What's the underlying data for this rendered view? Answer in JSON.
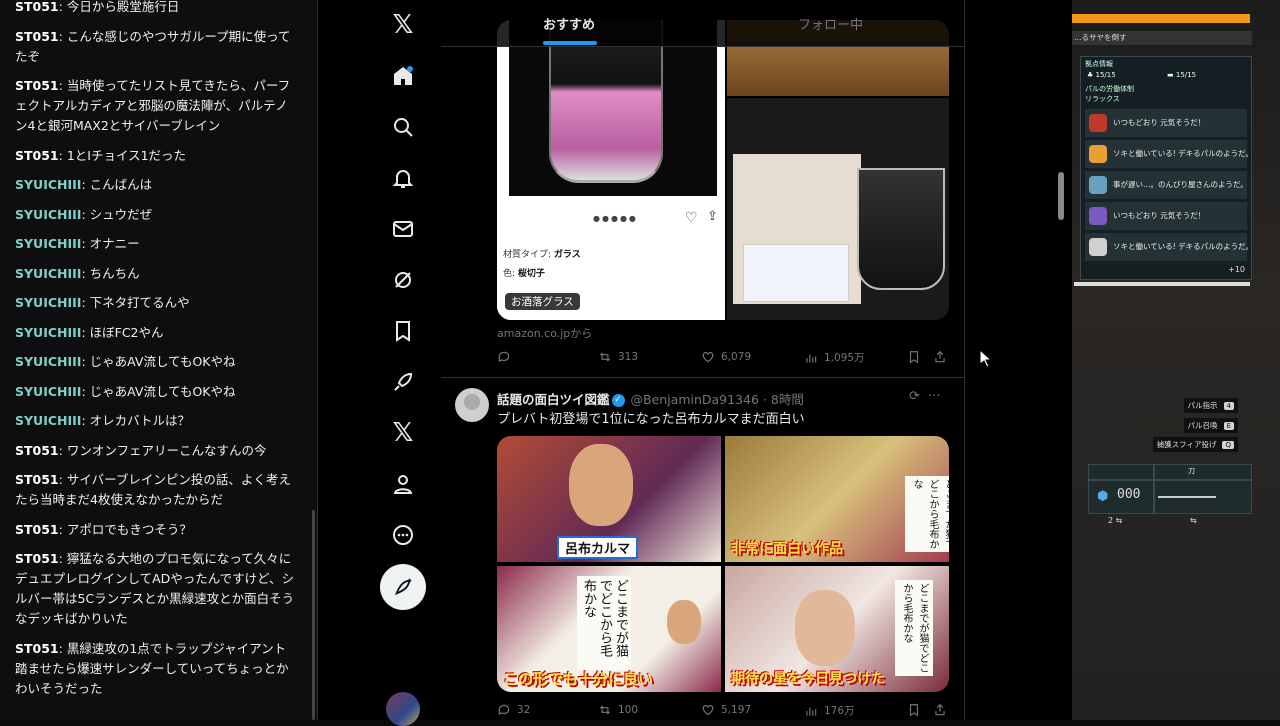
{
  "chat": {
    "messages": [
      {
        "user": "ST051",
        "text": "今日から殿堂施行日",
        "kind": "st"
      },
      {
        "user": "ST051",
        "text": "こんな感じのやつサガループ期に使ってたぞ",
        "kind": "st"
      },
      {
        "user": "ST051",
        "text": "当時使ってたリスト見てきたら、パーフェクトアルカディアと邪脳の魔法陣が、パルテノン4と銀河MAX2とサイバーブレイン",
        "kind": "st"
      },
      {
        "user": "ST051",
        "text": "1とIチョイス1だった",
        "kind": "st"
      },
      {
        "user": "SYUICHIII",
        "text": "こんばんは",
        "kind": "sy"
      },
      {
        "user": "SYUICHIII",
        "text": "シュウだぜ",
        "kind": "sy"
      },
      {
        "user": "SYUICHIII",
        "text": "オナニー",
        "kind": "sy"
      },
      {
        "user": "SYUICHIII",
        "text": "ちんちん",
        "kind": "sy"
      },
      {
        "user": "SYUICHIII",
        "text": "下ネタ打てるんや",
        "kind": "sy"
      },
      {
        "user": "SYUICHIII",
        "text": "ほぼFC2やん",
        "kind": "sy"
      },
      {
        "user": "SYUICHIII",
        "text": "じゃあAV流してもOKやね",
        "kind": "sy"
      },
      {
        "user": "SYUICHIII",
        "text": "じゃあAV流してもOKやね",
        "kind": "sy"
      },
      {
        "user": "SYUICHIII",
        "text": "オレカバトルは？",
        "kind": "sy"
      },
      {
        "user": "ST051",
        "text": "ワンオンフェアリーこんなすんの今",
        "kind": "st"
      },
      {
        "user": "ST051",
        "text": "サイバーブレインピン投の話、よく考えたら当時まだ4枚使えなかったからだ",
        "kind": "st"
      },
      {
        "user": "ST051",
        "text": "アポロでもきつそう？",
        "kind": "st"
      },
      {
        "user": "ST051",
        "text": "獰猛なる大地のプロモ気になって久々にデュエプレログインしてADやったんですけど、シルバー帯は5Cランデスとか黒緑速攻とか面白そうなデッキばかりいた",
        "kind": "st"
      },
      {
        "user": "ST051",
        "text": "黒緑速攻の1点でトラップジャイアント踏ませたら爆速サレンダーしていってちょっとかわいそうだった",
        "kind": "st"
      }
    ]
  },
  "twitter": {
    "tabs": {
      "recommended": "おすすめ",
      "following": "フォロー中"
    },
    "nav_icons": [
      "x-logo-icon",
      "home-icon",
      "search-icon",
      "bell-icon",
      "mail-icon",
      "grok-icon",
      "bookmark-icon",
      "rocket-icon",
      "x-premium-icon",
      "profile-icon",
      "more-icon"
    ],
    "x_glyph": "𝕏",
    "tweet1": {
      "product_specs": [
        {
          "label": "材質タイプ:",
          "value": "ガラス"
        },
        {
          "label": "色:",
          "value": "桜切子"
        }
      ],
      "alt_badge": "お酒落グラス",
      "source": "amazon.co.jpから",
      "stats": {
        "replies": "",
        "retweets": "313",
        "likes": "6,079",
        "views": "1,095万"
      }
    },
    "tweet2": {
      "name": "話題の面白ツイ図鑑",
      "handle": "@BenjaminDa91346",
      "time": "8時間",
      "text": "プレバト初登場で1位になった呂布カルマまだ面白い",
      "image_texts": {
        "nameplate": "呂布カルマ",
        "caption_q2": "非常に面白い作品",
        "caption_q3": "この形でも十分に良い",
        "caption_q4": "期待の星を今日見つけた",
        "poem": "どこまでが猫でどこから毛布かな"
      },
      "stats": {
        "replies": "32",
        "retweets": "100",
        "likes": "5,197",
        "views": "176万"
      }
    }
  },
  "game": {
    "quest": "…るサヤを倒す",
    "panel_title": "拠点情報",
    "stat1": "15/15",
    "stat2": "15/15",
    "labor": "パルの労働体制",
    "relax": "リラックス",
    "pals": [
      {
        "text": "いつもどおり 元気そうだ！",
        "color": "#c0392b"
      },
      {
        "text": "ソキと働いている! デキるパルのようだ。",
        "color": "#e8a030"
      },
      {
        "text": "事が遅い…。のんびり屋さんのようだ。",
        "color": "#6aa0c0"
      },
      {
        "text": "いつもどおり 元気そうだ！",
        "color": "#7a5ac0"
      },
      {
        "text": "ソキと働いている! デキるパルのようだ。",
        "color": "#d0d0d0"
      }
    ],
    "more": "+10",
    "hints": [
      {
        "label": "パル指示",
        "key": "4"
      },
      {
        "label": "パル召喚",
        "key": "E"
      },
      {
        "label": "捕獲スフィア投げ",
        "key": "Q"
      }
    ],
    "weapon_name": "刀",
    "ammo": "000",
    "sphere_count": "2"
  }
}
